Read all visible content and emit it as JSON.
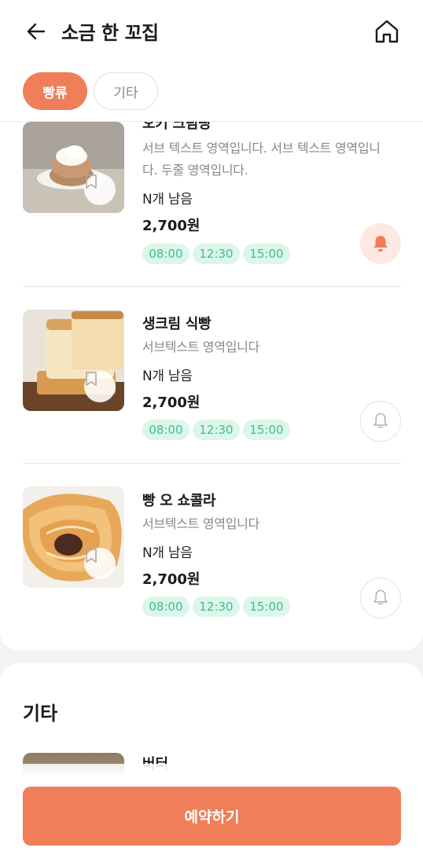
{
  "header": {
    "title": "소금 한 꼬집",
    "chips": [
      "빵류",
      "기타"
    ]
  },
  "items": [
    {
      "name": "오키 크림빵",
      "sub": "서브 텍스트 영역입니다. 서브 텍스트 영역입니다. 두줄 영역입니다.",
      "remain": "N개 남음",
      "price": "2,700원",
      "times": [
        "08:00",
        "12:30",
        "15:00"
      ],
      "bell_active": true
    },
    {
      "name": "생크림 식빵",
      "sub": "서브텍스트 영역입니다",
      "remain": "N개 남음",
      "price": "2,700원",
      "times": [
        "08:00",
        "12:30",
        "15:00"
      ],
      "bell_active": false
    },
    {
      "name": "빵 오 쇼콜라",
      "sub": "서브텍스트 영역입니다",
      "remain": "N개 남음",
      "price": "2,700원",
      "times": [
        "08:00",
        "12:30",
        "15:00"
      ],
      "bell_active": false
    }
  ],
  "section2": {
    "title": "기타",
    "peek_item_name": "버터"
  },
  "footer": {
    "reserve_label": "예약하기"
  },
  "colors": {
    "accent": "#ef7e59",
    "time_chip_bg": "#dcf6ea",
    "time_chip_text": "#3cbf8a"
  }
}
